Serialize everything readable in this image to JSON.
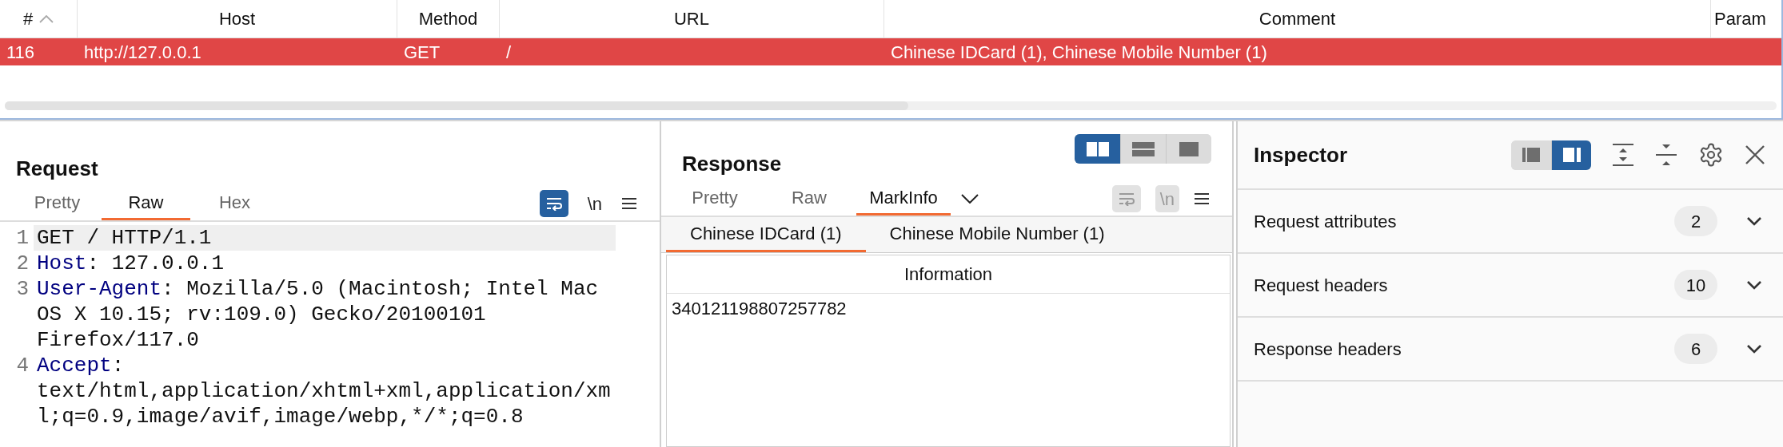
{
  "table": {
    "columns": [
      {
        "label": "#",
        "sorted": true
      },
      {
        "label": "Host",
        "sorted": false
      },
      {
        "label": "Method",
        "sorted": false
      },
      {
        "label": "URL",
        "sorted": false
      },
      {
        "label": "Comment",
        "sorted": false
      },
      {
        "label": "Param",
        "sorted": false
      }
    ],
    "rows": [
      {
        "cells": [
          "116",
          "http://127.0.0.1",
          "GET",
          "/",
          "Chinese IDCard (1), Chinese Mobile Number (1)"
        ],
        "selected": true
      }
    ]
  },
  "request": {
    "title": "Request",
    "tabs": [
      {
        "label": "Pretty",
        "selected": false
      },
      {
        "label": "Raw",
        "selected": true
      },
      {
        "label": "Hex",
        "selected": false
      }
    ],
    "toolbar": {
      "wrap_active": true,
      "disabled": false,
      "newline_label": "\\n"
    },
    "lines": [
      {
        "number": "1",
        "text": "GET / HTTP/1.1",
        "highlighted": true
      },
      {
        "number": "2",
        "key": "Host",
        "text": ": 127.0.0.1",
        "highlighted": false
      },
      {
        "number": "3",
        "key": "User-Agent",
        "text": ": Mozilla/5.0 (Macintosh; Intel Mac OS X 10.15; rv:109.0) Gecko/20100101 Firefox/117.0",
        "highlighted": false
      },
      {
        "number": "4",
        "key": "Accept",
        "text": ": text/html,application/xhtml+xml,application/xml;q=0.9,image/avif,image/webp,*/*;q=0.8",
        "highlighted": false
      }
    ]
  },
  "response": {
    "title": "Response",
    "layouts": [
      {
        "kind": "columns",
        "selected": true
      },
      {
        "kind": "rows",
        "selected": false
      },
      {
        "kind": "single",
        "selected": false
      }
    ],
    "tabs": [
      {
        "label": "Pretty",
        "selected": false
      },
      {
        "label": "Raw",
        "selected": false
      },
      {
        "label": "MarkInfo",
        "selected": true
      }
    ],
    "toolbar": {
      "wrap_active": false,
      "disabled": true,
      "newline_label": "\\n"
    },
    "subtabs": [
      {
        "label": "Chinese IDCard (1)",
        "selected": true
      },
      {
        "label": "Chinese Mobile Number (1)",
        "selected": false
      }
    ],
    "info_table": {
      "column": "Information",
      "rows": [
        "340121198807257782"
      ]
    }
  },
  "inspector": {
    "title": "Inspector",
    "layouts": [
      {
        "kind": "left",
        "selected": false
      },
      {
        "kind": "right",
        "selected": true
      }
    ],
    "sections": [
      {
        "label": "Request attributes",
        "count": "2",
        "expanded": false
      },
      {
        "label": "Request headers",
        "count": "10",
        "expanded": false
      },
      {
        "label": "Response headers",
        "count": "6",
        "expanded": false
      }
    ]
  }
}
